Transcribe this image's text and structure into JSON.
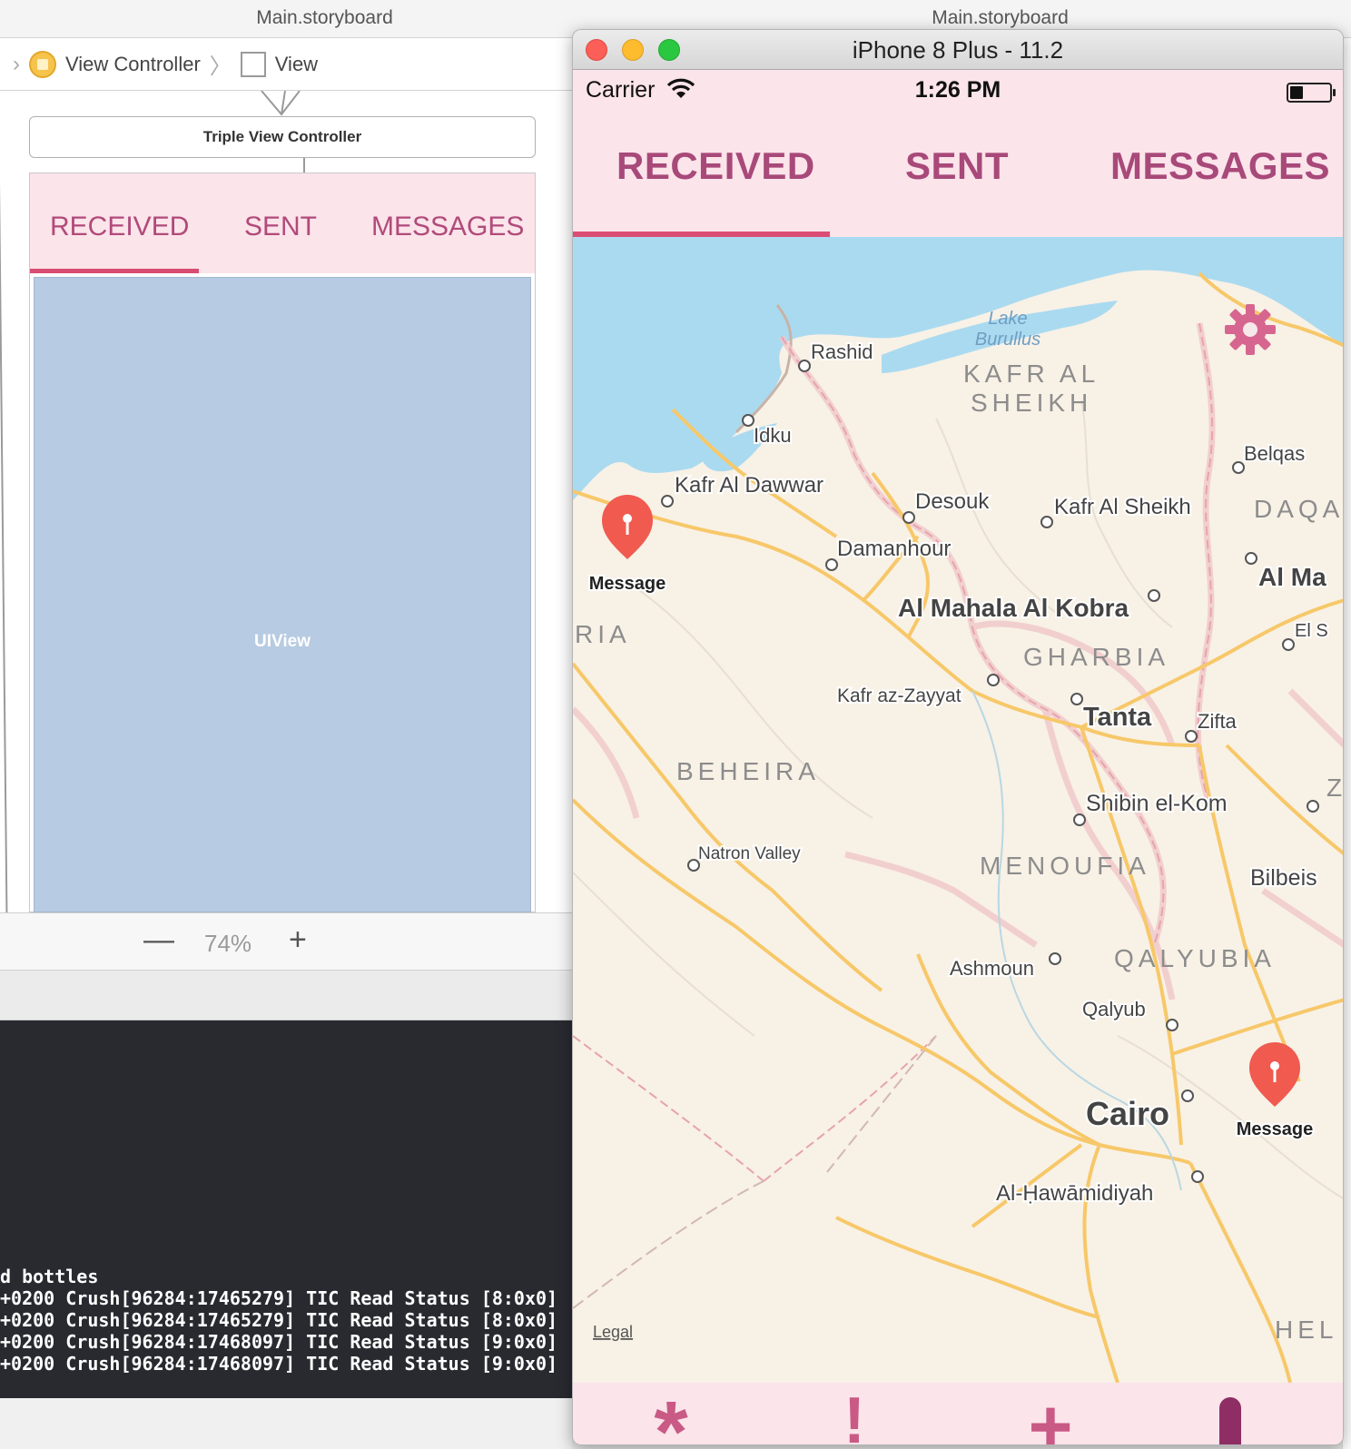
{
  "xcode": {
    "left_tab_title": "Main.storyboard",
    "right_tab_title": "Main.storyboard",
    "breadcrumb": [
      "View Controller",
      "View"
    ],
    "scene_title": "Triple View Controller",
    "storyboard_tabs": [
      "RECEIVED",
      "SENT",
      "MESSAGES"
    ],
    "uiview_label": "UIView",
    "zoom": {
      "out": "—",
      "value": "74%",
      "in": "+"
    },
    "console_lines": [
      "d bottles",
      "+0200 Crush[96284:17465279] TIC Read Status [8:0x0]",
      "+0200 Crush[96284:17465279] TIC Read Status [8:0x0]",
      "+0200 Crush[96284:17468097] TIC Read Status [9:0x0]",
      "+0200 Crush[96284:17468097] TIC Read Status [9:0x0]"
    ]
  },
  "simulator": {
    "window_title": "iPhone 8 Plus - 11.2",
    "status": {
      "carrier": "Carrier",
      "time": "1:26 PM"
    },
    "tabs": [
      "RECEIVED",
      "SENT",
      "MESSAGES"
    ],
    "selected_tab": "RECEIVED",
    "accent_color": "#dc4d76",
    "tab_text_color": "#a8497a",
    "map": {
      "water_labels": [
        "Lake",
        "Burullus"
      ],
      "region_labels": [
        "KAFR AL",
        "SHEIKH",
        "GHARBIA",
        "BEHEIRA",
        "MENOUFIA",
        "QALYUBIA",
        "DAQA",
        "RIA",
        "HEL",
        "Z"
      ],
      "city_labels": [
        "Rashid",
        "Idku",
        "Kafr Al Dawwar",
        "Desouk",
        "Kafr Al Sheikh",
        "Belqas",
        "Damanhour",
        "Al Mahala Al Kobra",
        "Al Ma",
        "El S",
        "Kafr az-Zayyat",
        "Tanta",
        "Zifta",
        "Shibin el-Kom",
        "Natron Valley",
        "Bilbeis",
        "Ashmoun",
        "Qalyub",
        "Cairo",
        "Al-Ḥawāmidiyah"
      ],
      "pins": [
        "Message",
        "Message"
      ],
      "legal": "Legal"
    },
    "bottom_bar": [
      "*",
      "!",
      "+",
      "|"
    ],
    "settings_icon": "gear-icon"
  }
}
